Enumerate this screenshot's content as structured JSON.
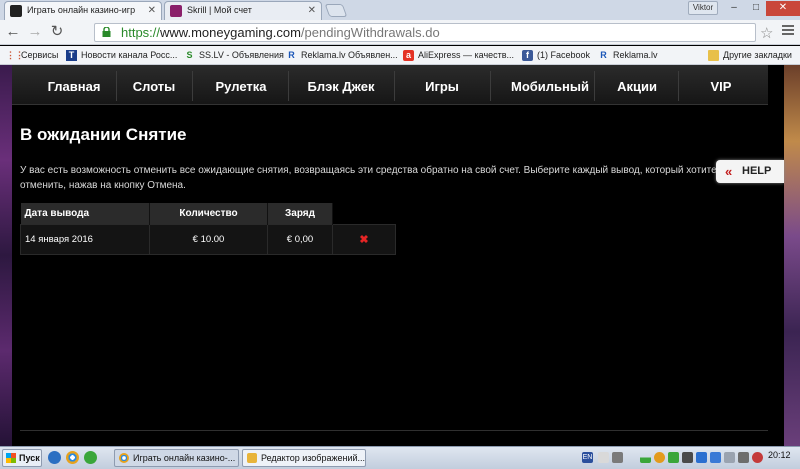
{
  "browser": {
    "tabs": [
      {
        "label": "Играть онлайн казино-игр",
        "active": true,
        "favicon_color": "#222222"
      },
      {
        "label": "Skrill | Мой счет",
        "active": false,
        "favicon_color": "#8a1f6a"
      }
    ],
    "user_button": "Viktor",
    "window_controls": {
      "minimize": "–",
      "maximize": "□",
      "close": "✕"
    },
    "url": {
      "scheme": "https://",
      "host": "www.moneygaming.com",
      "path": "/pendingWithdrawals.do"
    },
    "bookmarks": [
      {
        "label": "Сервисы",
        "icon": "apps-icon"
      },
      {
        "label": "Новости канала Росс...",
        "icon": "tv-icon"
      },
      {
        "label": "SS.LV - Объявления",
        "icon": "ss-icon"
      },
      {
        "label": "Reklama.lv Объявлен...",
        "icon": "r-icon"
      },
      {
        "label": "AliExpress — качеств...",
        "icon": "aliexpress-icon"
      },
      {
        "label": "(1) Facebook",
        "icon": "facebook-icon"
      },
      {
        "label": "Reklama.lv",
        "icon": "r-icon"
      },
      {
        "label": "Другие закладки",
        "icon": "folder-icon"
      }
    ]
  },
  "site": {
    "nav": [
      {
        "label": "Главная"
      },
      {
        "label": "Слоты"
      },
      {
        "label": "Рулетка"
      },
      {
        "label": "Блэк Джек"
      },
      {
        "label": "Игры"
      },
      {
        "label": "Мобильный"
      },
      {
        "label": "Акции"
      },
      {
        "label": "VIP"
      }
    ],
    "title": "В ожидании Снятие",
    "description": "У вас есть возможность отменить все ожидающие снятия, возвращаясь эти средства обратно на свой счет. Выберите каждый вывод, который хотите отменить, нажав на кнопку Отмена.",
    "table": {
      "headers": [
        "Дата вывода",
        "Количество",
        "Заряд"
      ],
      "rows": [
        {
          "date": "14 января 2016",
          "amount": "€ 10.00",
          "fee": "€ 0,00",
          "cancel": "✖"
        }
      ]
    },
    "help_button": "HELP",
    "colors": {
      "accent_red": "#e52525",
      "background": "#000000"
    }
  },
  "taskbar": {
    "start_label": "Пуск",
    "items": [
      {
        "label": "Играть онлайн казино-...",
        "active": true
      },
      {
        "label": "Редактор изображений...",
        "active": false
      }
    ],
    "lang": "EN",
    "clock": "20:12"
  }
}
